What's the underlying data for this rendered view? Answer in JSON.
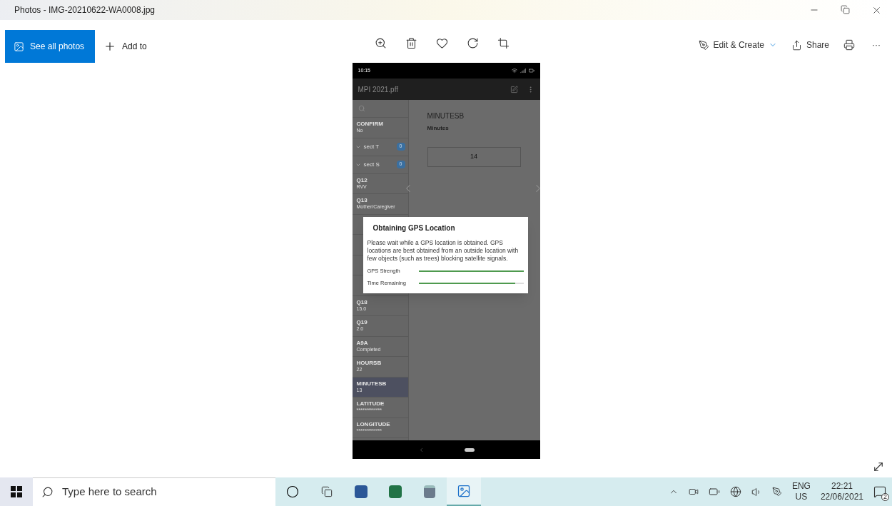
{
  "window": {
    "title": "Photos - IMG-20210622-WA0008.jpg"
  },
  "toolbar": {
    "see_all": "See all photos",
    "add_to": "Add to",
    "edit_create": "Edit & Create",
    "share": "Share",
    "more": "···"
  },
  "phone": {
    "status_time": "10:15",
    "app_title": "MPI 2021.pff",
    "sidebar": [
      {
        "kind": "search"
      },
      {
        "kind": "field",
        "name": "CONFIRM",
        "value": "No",
        "selected": false
      },
      {
        "kind": "section",
        "name": "sect T",
        "badge": "0"
      },
      {
        "kind": "section",
        "name": "sect S",
        "badge": "0"
      },
      {
        "kind": "field",
        "name": "Q12",
        "value": "RVV",
        "selected": false
      },
      {
        "kind": "field",
        "name": "Q13",
        "value": "Mother/Caregiver",
        "selected": false
      },
      {
        "kind": "hidden"
      },
      {
        "kind": "hidden"
      },
      {
        "kind": "hidden"
      },
      {
        "kind": "hidden"
      },
      {
        "kind": "field",
        "name": "Q18",
        "value": "15.0",
        "selected": false
      },
      {
        "kind": "field",
        "name": "Q19",
        "value": "2.0",
        "selected": false
      },
      {
        "kind": "field",
        "name": "A9A",
        "value": "Completed",
        "selected": false
      },
      {
        "kind": "field",
        "name": "HOURSB",
        "value": "22",
        "selected": false
      },
      {
        "kind": "field",
        "name": "MINUTESB",
        "value": "13",
        "selected": true
      },
      {
        "kind": "field",
        "name": "LATITUDE",
        "value": "*************",
        "selected": false
      },
      {
        "kind": "field",
        "name": "LONGITUDE",
        "value": "*************",
        "selected": false
      }
    ],
    "question": {
      "name": "MINUTESB",
      "label": "Minutes",
      "value": "14"
    },
    "dialog": {
      "title": "Obtaining GPS Location",
      "message": "Please wait while a GPS location is obtained. GPS locations are best obtained from an outside location with few objects (such as trees) blocking satellite signals.",
      "meters": [
        {
          "label": "GPS Strength",
          "level": 1.0
        },
        {
          "label": "Time Remaining",
          "level": 0.92
        }
      ]
    }
  },
  "taskbar": {
    "search_placeholder": "Type here to search",
    "apps": [
      {
        "kind": "cortana",
        "selected": false
      },
      {
        "kind": "taskview",
        "selected": false
      },
      {
        "kind": "word",
        "selected": false
      },
      {
        "kind": "excel",
        "selected": false
      },
      {
        "kind": "calculator",
        "selected": false
      },
      {
        "kind": "photos",
        "selected": true
      }
    ],
    "lang": "ENG",
    "region": "US",
    "time": "22:21",
    "date": "22/06/2021",
    "notifications": "2"
  }
}
